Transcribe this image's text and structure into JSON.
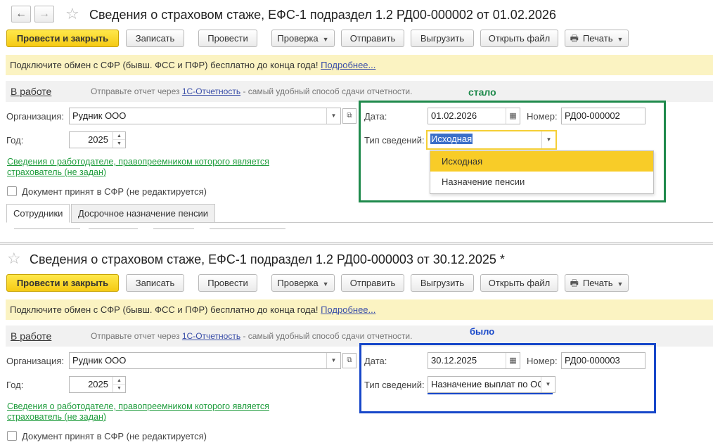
{
  "top_form": {
    "title": "Сведения о страховом стаже, ЕФС-1 подраздел 1.2 РД00-000002 от 01.02.2026",
    "annotation": "стало",
    "date": "01.02.2026",
    "number": "РД00-000002",
    "info_type": "Исходная",
    "info_type_options": [
      "Исходная",
      "Назначение пенсии"
    ],
    "tabs": [
      "Сотрудники",
      "Досрочное назначение пенсии"
    ]
  },
  "bottom_form": {
    "title": "Сведения о страховом стаже, ЕФС-1 подраздел 1.2 РД00-000003 от 30.12.2025 *",
    "annotation": "было",
    "date": "30.12.2025",
    "number": "РД00-000003",
    "info_type": "Назначение выплат по ОС"
  },
  "nav": {
    "back": "←",
    "forward": "→"
  },
  "toolbar": {
    "post_and_close": "Провести и закрыть",
    "save": "Записать",
    "post": "Провести",
    "check": "Проверка",
    "send": "Отправить",
    "export": "Выгрузить",
    "open_file": "Открыть файл",
    "print": "Печать"
  },
  "banner": {
    "text": "Подключите обмен с СФР (бывш. ФСС и ПФР) бесплатно до конца года!",
    "link": "Подробнее..."
  },
  "status": {
    "state": "В работе",
    "hint_before": "Отправьте отчет через",
    "hint_link": "1С-Отчетность",
    "hint_after": "- самый удобный способ сдачи отчетности."
  },
  "fields": {
    "org_label": "Организация:",
    "org_value": "Рудник ООО",
    "year_label": "Год:",
    "year_value": "2025",
    "date_label": "Дата:",
    "number_label": "Номер:",
    "info_type_label": "Тип сведений:",
    "employer_link": "Сведения о работодателе, правопреемником которого является страхователь (не задан)",
    "accepted_checkbox": "Документ принят в СФР (не редактируется)"
  },
  "colors": {
    "accent_yellow": "#f5ca14",
    "annotation_green": "#1f8a4c",
    "annotation_blue": "#1747c9",
    "banner_bg": "#fbf3c2"
  }
}
